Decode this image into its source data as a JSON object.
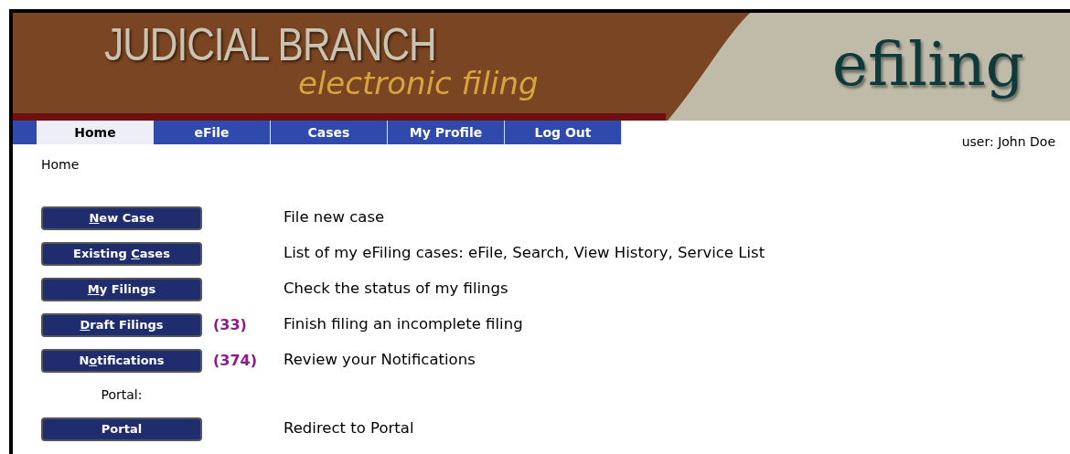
{
  "header": {
    "title": "JUDICIAL BRANCH",
    "subtitle": "electronic filing",
    "logo": "efiling"
  },
  "nav": {
    "tabs": [
      {
        "label": "Home",
        "selected": true
      },
      {
        "label": "eFile",
        "selected": false
      },
      {
        "label": "Cases",
        "selected": false
      },
      {
        "label": "My Profile",
        "selected": false
      },
      {
        "label": "Log Out",
        "selected": false
      }
    ]
  },
  "user": "user: John Doe",
  "breadcrumb": "Home",
  "actions": [
    {
      "kind": "button",
      "label": {
        "key": "N",
        "after": "ew Case"
      },
      "description": "File new case"
    },
    {
      "kind": "button",
      "label": {
        "before": "Existing ",
        "key": "C",
        "after": "ases"
      },
      "description": "List of my eFiling cases: eFile, Search, View History, Service List"
    },
    {
      "kind": "button",
      "label": {
        "key": "M",
        "after": "y Filings"
      },
      "description": "Check the status of my filings"
    },
    {
      "kind": "button",
      "label": {
        "key": "D",
        "after": "raft Filings"
      },
      "count": "(33)",
      "description": "Finish filing an incomplete filing"
    },
    {
      "kind": "button",
      "label": {
        "before": "N",
        "key": "o",
        "after": "tifications"
      },
      "count": "(374)",
      "description": "Review your Notifications"
    },
    {
      "kind": "heading",
      "text": "Portal:"
    },
    {
      "kind": "button",
      "label": {
        "before": "Portal"
      },
      "description": "Redirect to Portal"
    }
  ]
}
